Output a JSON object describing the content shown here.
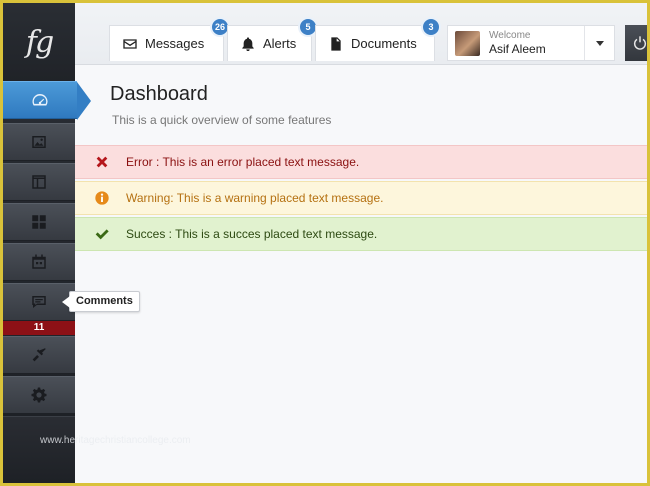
{
  "logo": {
    "text": "fg"
  },
  "sidebar": {
    "items": [
      {
        "id": "dashboard",
        "icon": "dashboard-gauge-icon",
        "active": true
      },
      {
        "id": "gallery",
        "icon": "image-icon"
      },
      {
        "id": "layout",
        "icon": "layout-icon"
      },
      {
        "id": "widgets",
        "icon": "grid-icon"
      },
      {
        "id": "calendar",
        "icon": "calendar-icon"
      },
      {
        "id": "comments",
        "icon": "comment-icon",
        "tooltip": "Comments",
        "count": "11"
      },
      {
        "id": "tools",
        "icon": "tools-icon"
      },
      {
        "id": "settings",
        "icon": "gear-icon"
      }
    ]
  },
  "topbar": {
    "tabs": [
      {
        "label": "Messages",
        "icon": "envelope-icon",
        "badge": "26"
      },
      {
        "label": "Alerts",
        "icon": "bell-icon",
        "badge": "5"
      },
      {
        "label": "Documents",
        "icon": "document-icon",
        "badge": "3"
      }
    ],
    "user": {
      "welcome": "Welcome",
      "name": "Asif Aleem"
    }
  },
  "page": {
    "title": "Dashboard",
    "subtitle": "This is a quick overview of some features"
  },
  "alerts": {
    "error": "Error : This is an error placed text message.",
    "warning": "Warning: This is a warning placed text message.",
    "success": "Succes : This is a succes placed text message."
  },
  "watermark": "www.heritagechristiancollege.com",
  "colors": {
    "accent": "#3d80c6",
    "error_bg": "#fbdede",
    "warning_bg": "#fdf6dc",
    "success_bg": "#e1f2cf",
    "badge_red": "#8d1116"
  }
}
